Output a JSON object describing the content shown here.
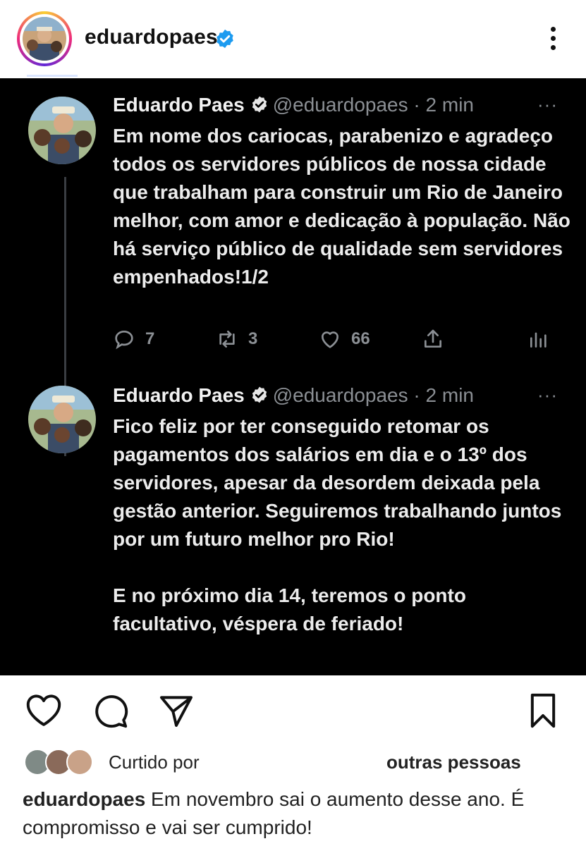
{
  "post": {
    "username": "eduardopaes",
    "verified_icon": "verified-badge-icon",
    "more_icon": "more-vertical-icon"
  },
  "tweets": [
    {
      "name": "Eduardo Paes",
      "handle_time": "@eduardopaes · 2 min",
      "text": "Em nome dos cariocas, parabenizo e agradeço todos os servidores públicos de nossa cidade que trabalham para construir um Rio de Janeiro melhor, com amor e dedicação à população. Não há serviço público de qualidade sem servidores empenhados!1/2",
      "replies": "7",
      "retweets": "3",
      "likes": "66"
    },
    {
      "name": "Eduardo Paes",
      "handle_time": "@eduardopaes · 2 min",
      "text": "Fico feliz por ter conseguido retomar os pagamentos dos salários em dia e o 13º dos servidores, apesar da desordem deixada pela gestão anterior. Seguiremos trabalhando juntos por um futuro melhor pro Rio!\n\nE no próximo dia 14, teremos o ponto facultativo, véspera de feriado!"
    }
  ],
  "tweet_more": "···",
  "footer": {
    "liked_label": "Curtido por",
    "liked_others": "outras pessoas",
    "caption_user": "eduardopaes",
    "caption_text": " Em novembro sai o aumento desse ano.  É compromisso e vai ser cumprido!"
  },
  "colors": {
    "tweet_background": "#000000",
    "verified_blue": "#1d9bf0",
    "tweet_text": "#ececec",
    "tweet_muted": "#8b8f94"
  }
}
